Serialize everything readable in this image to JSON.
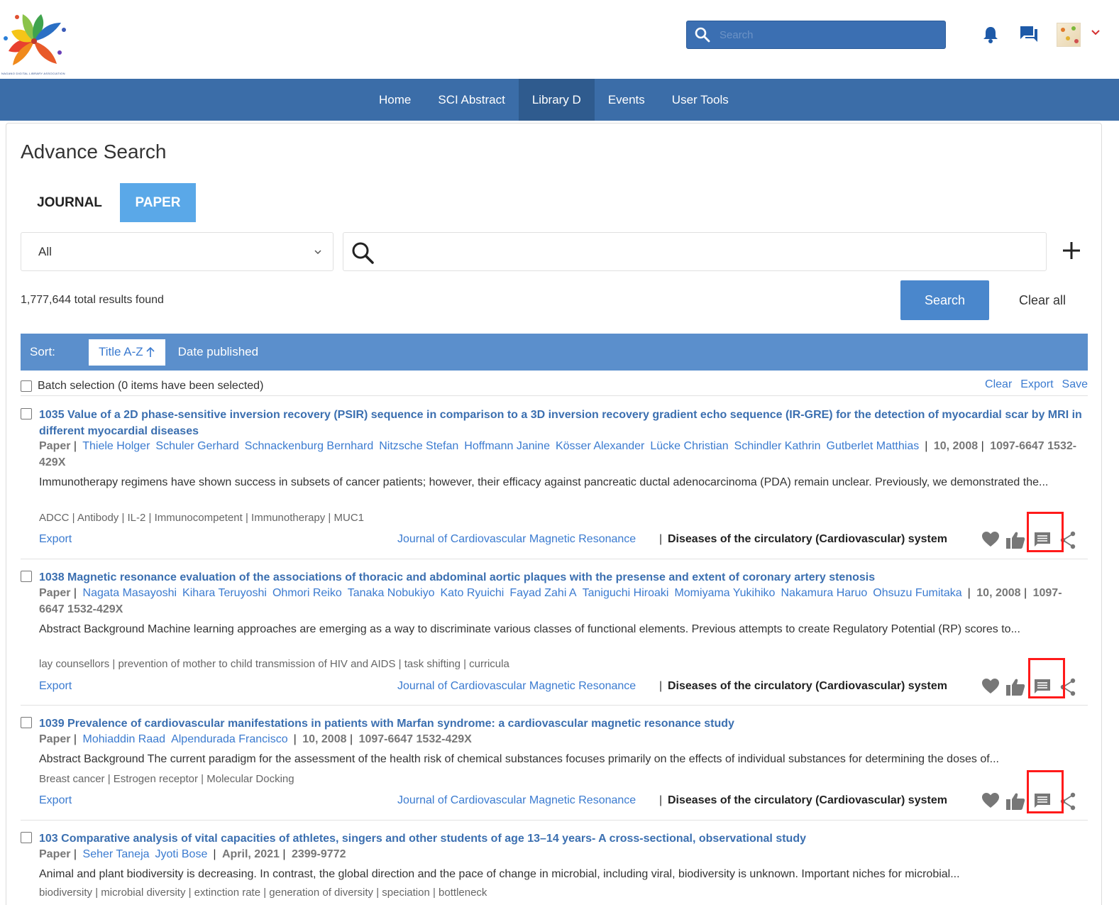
{
  "header": {
    "logo_text": "NAGANO DIGITAL LIBRARY ASSOCIATION",
    "search_placeholder": "Search"
  },
  "nav": {
    "items": [
      {
        "label": "Home"
      },
      {
        "label": "SCI Abstract"
      },
      {
        "label": "Library D",
        "active": true
      },
      {
        "label": "Events"
      },
      {
        "label": "User Tools"
      }
    ]
  },
  "page": {
    "title": "Advance Search",
    "tabs": [
      {
        "label": "JOURNAL"
      },
      {
        "label": "PAPER",
        "active": true
      }
    ],
    "field_select": "All",
    "results_count": "1,777,644 total results found",
    "search_button": "Search",
    "clear_all_button": "Clear all"
  },
  "sort": {
    "label": "Sort:",
    "options": [
      {
        "label": "Title A-Z",
        "active": true
      },
      {
        "label": "Date published"
      }
    ]
  },
  "batch": {
    "label": "Batch selection (0 items have been selected)",
    "actions": [
      "Clear",
      "Export",
      "Save"
    ]
  },
  "entries": [
    {
      "title": "1035 Value of a 2D phase-sensitive inversion recovery (PSIR) sequence in comparison to a 3D inversion recovery gradient echo sequence (IR-GRE) for the detection of myocardial scar by MRI in different myocardial diseases",
      "type": "Paper",
      "authors": [
        "Thiele Holger",
        "Schuler Gerhard",
        "Schnackenburg Bernhard",
        "Nitzsche Stefan",
        "Hoffmann Janine",
        "Kösser Alexander",
        "Lücke Christian",
        "Schindler Kathrin",
        "Gutberlet Matthias"
      ],
      "date": "10, 2008",
      "issn": "1097-6647 1532-429X",
      "abstract": "Immunotherapy regimens have shown success in subsets of cancer patients; however, their efficacy against pancreatic ductal adenocarcinoma (PDA) remain unclear. Previously, we demonstrated the...",
      "keywords": "ADCC | Antibody | IL-2 | Immunocompetent | Immunotherapy | MUC1",
      "export": "Export",
      "journal": "Journal of Cardiovascular Magnetic Resonance",
      "pipe": "|",
      "subject": "Diseases of the circulatory (Cardiovascular) system"
    },
    {
      "title": "1038 Magnetic resonance evaluation of the associations of thoracic and abdominal aortic plaques with the presense and extent of coronary artery stenosis",
      "type": "Paper",
      "authors": [
        "Nagata Masayoshi",
        "Kihara Teruyoshi",
        "Ohmori Reiko",
        "Tanaka Nobukiyo",
        "Kato Ryuichi",
        "Fayad Zahi A",
        "Taniguchi Hiroaki",
        "Momiyama Yukihiko",
        "Nakamura Haruo",
        "Ohsuzu Fumitaka"
      ],
      "date": "10, 2008",
      "issn": "1097-6647 1532-429X",
      "abstract": "Abstract Background Machine learning approaches are emerging as a way to discriminate various classes of functional elements. Previous attempts to create Regulatory Potential (RP) scores to...",
      "keywords": "lay counsellors | prevention of mother to child transmission of HIV and AIDS | task shifting | curricula",
      "export": "Export",
      "journal": "Journal of Cardiovascular Magnetic Resonance",
      "pipe": "|",
      "subject": "Diseases of the circulatory (Cardiovascular) system"
    },
    {
      "title": "1039 Prevalence of cardiovascular manifestations in patients with Marfan syndrome: a cardiovascular magnetic resonance study",
      "type": "Paper",
      "authors": [
        "Mohiaddin Raad",
        "Alpendurada Francisco"
      ],
      "date": "10, 2008",
      "issn": "1097-6647 1532-429X",
      "abstract": "Abstract Background The current paradigm for the assessment of the health risk of chemical substances focuses primarily on the effects of individual substances for determining the doses of...",
      "keywords": "Breast cancer | Estrogen receptor | Molecular Docking",
      "export": "Export",
      "journal": "Journal of Cardiovascular Magnetic Resonance",
      "pipe": "|",
      "subject": "Diseases of the circulatory (Cardiovascular) system"
    },
    {
      "title": "103 Comparative analysis of vital capacities of athletes, singers and other students of age 13–14 years- A cross-sectional, observational study",
      "type": "Paper",
      "authors": [
        "Seher Taneja",
        "Jyoti Bose"
      ],
      "date": "April, 2021",
      "issn": "2399-9772",
      "abstract": "Animal and plant biodiversity is decreasing. In contrast, the global direction and the pace of change in microbial, including viral, biodiversity is unknown. Important niches for microbial...",
      "keywords": "biodiversity | microbial diversity | extinction rate | generation of diversity | speciation | bottleneck"
    }
  ],
  "colors": {
    "nav_bg": "#3b6da8",
    "accent": "#5aa8e8",
    "link": "#3b7bd0",
    "highlight": "#ff1a1a"
  }
}
